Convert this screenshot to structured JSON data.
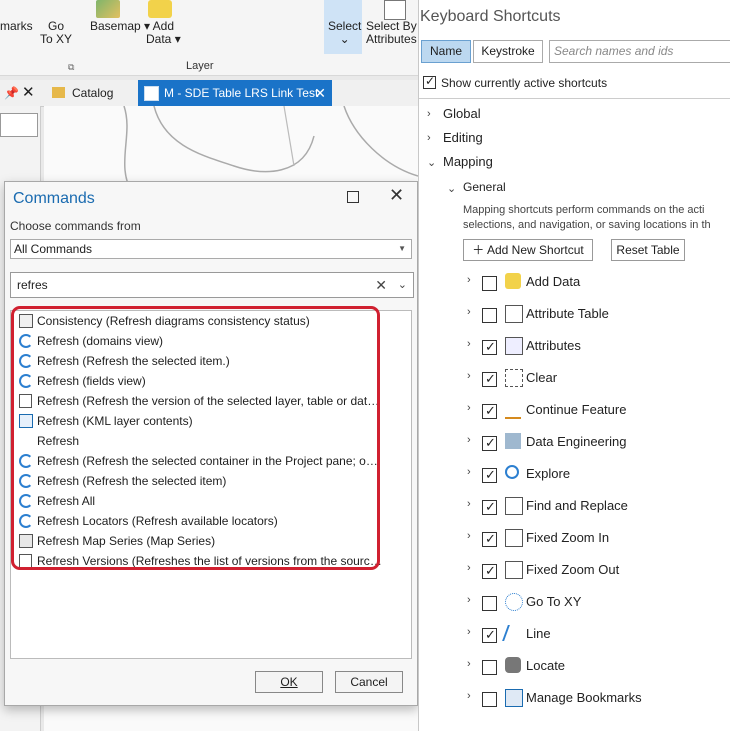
{
  "ribbon": {
    "bookmarks_label": "marks",
    "goto_label_1": "Go",
    "goto_label_2": "To XY",
    "basemap_label": "Basemap",
    "add_data_label_1": "Add",
    "add_data_label_2": "Data",
    "layer_group": "Layer",
    "select_label": "Select",
    "select_by_attr_1": "Select By",
    "select_by_attr_2": "Attributes"
  },
  "doc_tabs": {
    "catalog": "Catalog",
    "map": "M - SDE Table LRS Link Test"
  },
  "commands_dialog": {
    "title": "Commands",
    "choose_label": "Choose commands from",
    "source_value": "All Commands",
    "search_value": "refres",
    "ok": "OK",
    "cancel": "Cancel",
    "items": [
      {
        "label": "Consistency (Refresh diagrams consistency status)",
        "icon": "diagram-icon"
      },
      {
        "label": "Refresh (domains view)",
        "icon": "refresh-icon"
      },
      {
        "label": "Refresh (Refresh the selected item.)",
        "icon": "refresh-icon"
      },
      {
        "label": "Refresh (fields view)",
        "icon": "refresh-icon"
      },
      {
        "label": "Refresh (Refresh the version of the selected layer, table or datas...",
        "icon": "doc-refresh-icon"
      },
      {
        "label": "Refresh (KML layer contents)",
        "icon": "kml-icon"
      },
      {
        "label": "Refresh",
        "icon": ""
      },
      {
        "label": "Refresh (Refresh the selected container in the Project pane; on c...",
        "icon": "refresh-icon"
      },
      {
        "label": "Refresh (Refresh the selected item)",
        "icon": "refresh-icon"
      },
      {
        "label": "Refresh All",
        "icon": "refresh-icon"
      },
      {
        "label": "Refresh Locators (Refresh available locators)",
        "icon": "refresh-icon"
      },
      {
        "label": "Refresh Map Series (Map Series)",
        "icon": "map-series-icon"
      },
      {
        "label": "Refresh Versions (Refreshes the list of versions from the source i...",
        "icon": "doc-refresh-icon"
      }
    ]
  },
  "shortcuts": {
    "title": "Keyboard Shortcuts",
    "tab_name": "Name",
    "tab_keystroke": "Keystroke",
    "search_placeholder": "Search names and ids",
    "show_active_label": "Show currently active shortcuts",
    "show_active_checked": true,
    "categories": {
      "global": "Global",
      "editing": "Editing",
      "mapping": "Mapping",
      "general": "General"
    },
    "description_1": "Mapping shortcuts perform commands on the acti",
    "description_2": "selections, and navigation, or saving locations in th",
    "add_shortcut": "Add New Shortcut",
    "reset_table": "Reset Table",
    "rows": [
      {
        "label": "Add Data",
        "checked": false,
        "icon": "add-data-icon"
      },
      {
        "label": "Attribute Table",
        "checked": false,
        "icon": "table-icon"
      },
      {
        "label": "Attributes",
        "checked": true,
        "icon": "attributes-icon"
      },
      {
        "label": "Clear",
        "checked": true,
        "icon": "clear-selection-icon"
      },
      {
        "label": "Continue Feature",
        "checked": true,
        "icon": "continue-feature-icon"
      },
      {
        "label": "Data Engineering",
        "checked": true,
        "icon": "data-engineering-icon"
      },
      {
        "label": "Explore",
        "checked": true,
        "icon": "explore-icon"
      },
      {
        "label": "Find and Replace",
        "checked": true,
        "icon": "find-replace-icon"
      },
      {
        "label": "Fixed Zoom In",
        "checked": true,
        "icon": "zoom-in-icon"
      },
      {
        "label": "Fixed Zoom Out",
        "checked": true,
        "icon": "zoom-out-icon"
      },
      {
        "label": "Go To XY",
        "checked": false,
        "icon": "goto-xy-icon"
      },
      {
        "label": "Line",
        "checked": true,
        "icon": "line-icon"
      },
      {
        "label": "Locate",
        "checked": false,
        "icon": "locate-icon"
      },
      {
        "label": "Manage Bookmarks",
        "checked": false,
        "icon": "bookmarks-icon"
      }
    ]
  }
}
